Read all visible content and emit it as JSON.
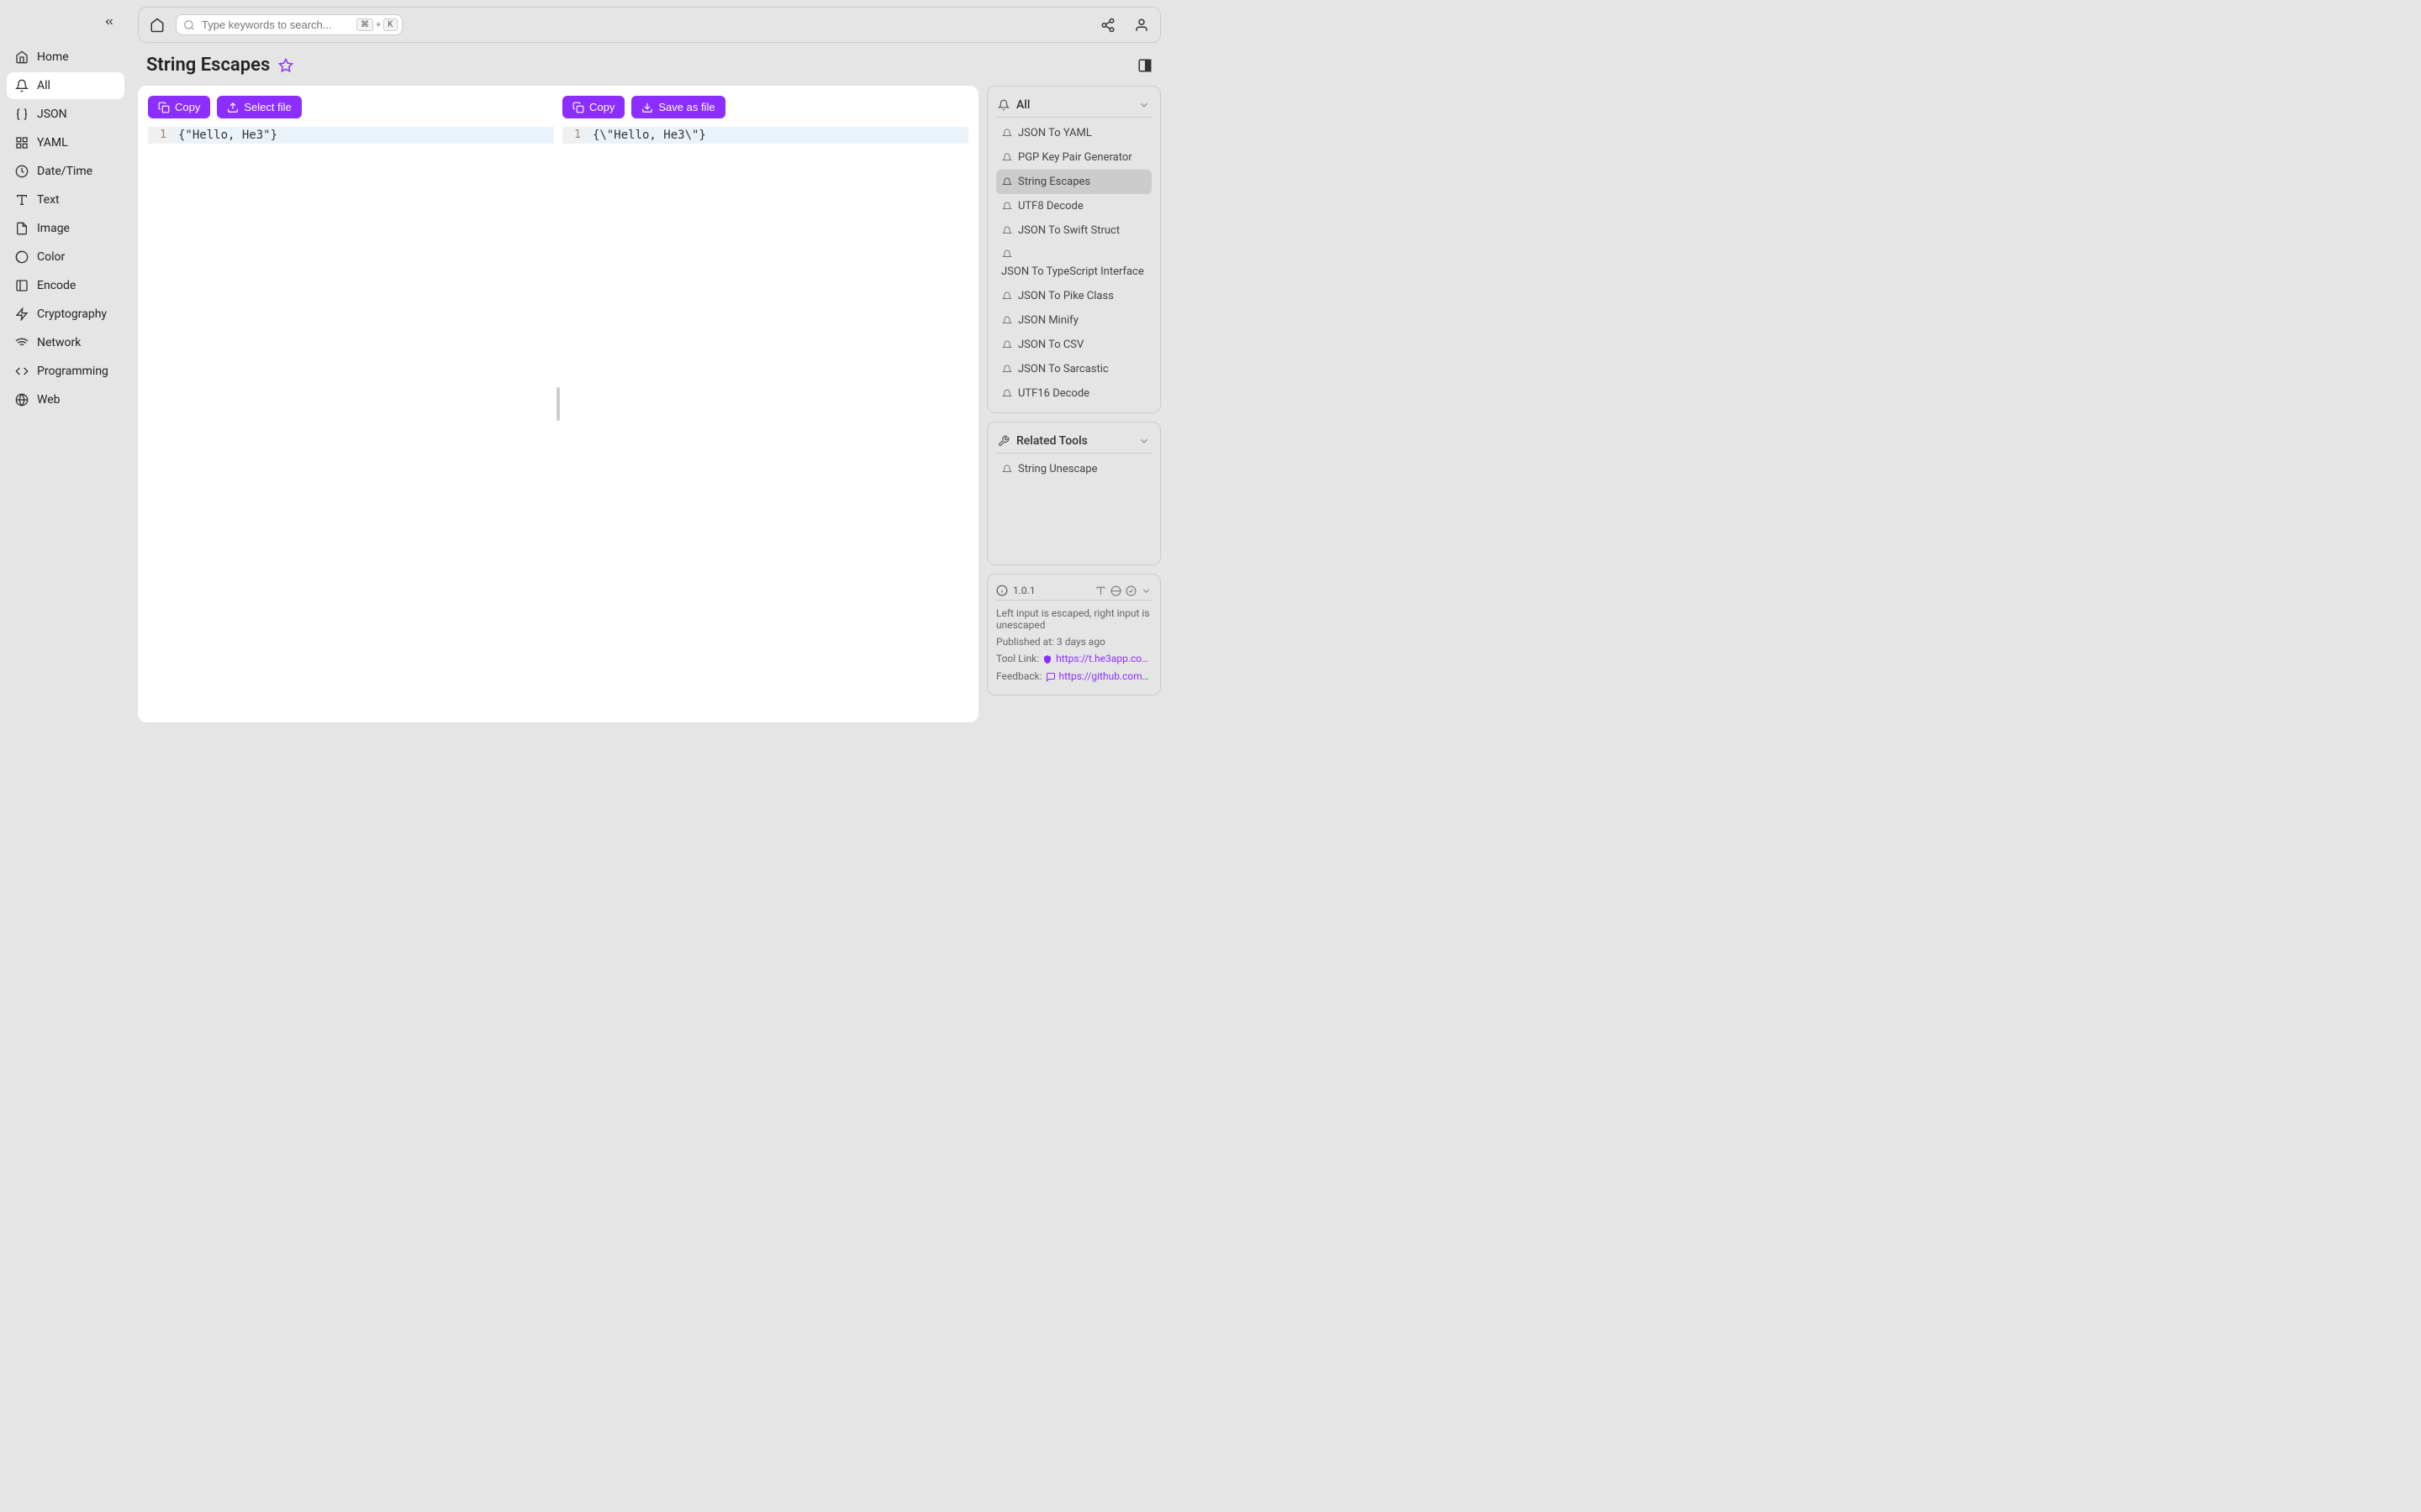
{
  "topbar": {
    "search_placeholder": "Type keywords to search...",
    "shortcut_key1": "⌘",
    "shortcut_plus": "+",
    "shortcut_key2": "K"
  },
  "sidebar": {
    "items": [
      {
        "label": "Home",
        "icon": "home"
      },
      {
        "label": "All",
        "icon": "bell",
        "active": true
      },
      {
        "label": "JSON",
        "icon": "braces"
      },
      {
        "label": "YAML",
        "icon": "grid"
      },
      {
        "label": "Date/Time",
        "icon": "clock"
      },
      {
        "label": "Text",
        "icon": "text"
      },
      {
        "label": "Image",
        "icon": "file"
      },
      {
        "label": "Color",
        "icon": "palette"
      },
      {
        "label": "Encode",
        "icon": "encode"
      },
      {
        "label": "Cryptography",
        "icon": "bolt"
      },
      {
        "label": "Network",
        "icon": "wifi"
      },
      {
        "label": "Programming",
        "icon": "code"
      },
      {
        "label": "Web",
        "icon": "globe"
      }
    ]
  },
  "page": {
    "title": "String Escapes"
  },
  "editors": {
    "left": {
      "copy_label": "Copy",
      "select_file_label": "Select file",
      "line_number": "1",
      "content": "{\"Hello, He3\"}"
    },
    "right": {
      "copy_label": "Copy",
      "save_file_label": "Save as file",
      "line_number": "1",
      "content": "{\\\"Hello, He3\\\"}"
    }
  },
  "rightpanel": {
    "all_header": "All",
    "tools": [
      {
        "label": "JSON To YAML"
      },
      {
        "label": "PGP Key Pair Generator"
      },
      {
        "label": "String Escapes",
        "active": true
      },
      {
        "label": "UTF8 Decode"
      },
      {
        "label": "JSON To Swift Struct"
      },
      {
        "label": "JSON To TypeScript Interface"
      },
      {
        "label": "JSON To Pike Class"
      },
      {
        "label": "JSON Minify"
      },
      {
        "label": "JSON To CSV"
      },
      {
        "label": "JSON To Sarcastic"
      },
      {
        "label": "UTF16 Decode"
      }
    ],
    "related_header": "Related Tools",
    "related": [
      {
        "label": "String Unescape"
      }
    ]
  },
  "info": {
    "version": "1.0.1",
    "description": "Left input is escaped, right input is unescaped",
    "published_label": "Published at: ",
    "published_value": "3 days ago",
    "tool_link_label": "Tool Link: ",
    "tool_link_value": "https://t.he3app.co…",
    "feedback_label": "Feedback: ",
    "feedback_value": "https://github.com/…"
  }
}
